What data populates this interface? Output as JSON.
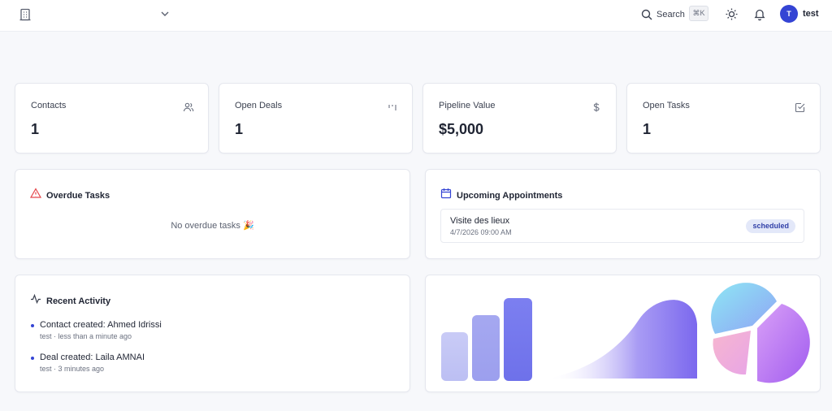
{
  "header": {
    "search_label": "Search",
    "search_shortcut": "⌘K",
    "user_initial": "T",
    "user_name": "test",
    "accent_color": "#3444d4"
  },
  "stats": [
    {
      "label": "Contacts",
      "value": "1",
      "icon": "users-icon"
    },
    {
      "label": "Open Deals",
      "value": "1",
      "icon": "kanban-icon"
    },
    {
      "label": "Pipeline Value",
      "value": "$5,000",
      "icon": "dollar-icon"
    },
    {
      "label": "Open Tasks",
      "value": "1",
      "icon": "checkbox-icon"
    }
  ],
  "overdue": {
    "title": "Overdue Tasks",
    "empty_message": "No overdue tasks 🎉",
    "icon": "alert-triangle-icon",
    "icon_color": "#e5484d"
  },
  "appointments": {
    "title": "Upcoming Appointments",
    "icon": "calendar-icon",
    "items": [
      {
        "title": "Visite des lieux",
        "datetime": "4/7/2026 09:00 AM",
        "status": "scheduled"
      }
    ]
  },
  "activity": {
    "title": "Recent Activity",
    "icon": "activity-icon",
    "items": [
      {
        "text": "Contact created: Ahmed Idrissi",
        "meta": "test · less than a minute ago"
      },
      {
        "text": "Deal created: Laila AMNAI",
        "meta": "test · 3 minutes ago"
      }
    ]
  }
}
